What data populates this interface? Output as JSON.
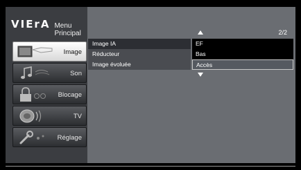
{
  "header": {
    "logo": "VIErA",
    "menu_title": "Menu Principal",
    "page_indicator": "2/2"
  },
  "sidebar": {
    "items": [
      {
        "label": "Image",
        "icon": "image-icon",
        "selected": true
      },
      {
        "label": "Son",
        "icon": "music-icon",
        "selected": false
      },
      {
        "label": "Blocage",
        "icon": "lock-icon",
        "selected": false
      },
      {
        "label": "TV",
        "icon": "satellite-icon",
        "selected": false
      },
      {
        "label": "Réglage",
        "icon": "wrench-icon",
        "selected": false
      }
    ]
  },
  "settings": {
    "rows": [
      {
        "name": "Image IA",
        "value": "EF"
      },
      {
        "name": "Réducteur",
        "value": "Bas"
      },
      {
        "name": "Image évoluée",
        "value": "Accès"
      }
    ]
  },
  "scroll": {
    "up_icon": "triangle-up-icon",
    "down_icon": "triangle-down-icon"
  },
  "colors": {
    "panel_bg": "#6a6d72",
    "sidebar_bg": "#3b3d41",
    "selected_item_bg": "#ffffff",
    "highlight_value_bg": "#555960"
  }
}
